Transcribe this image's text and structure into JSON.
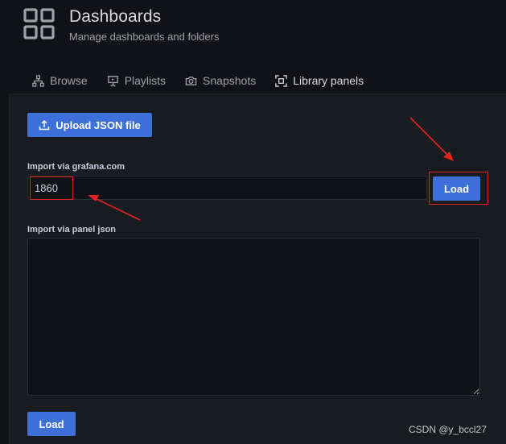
{
  "header": {
    "icon": "dashboards-grid-icon",
    "title": "Dashboards",
    "subtitle": "Manage dashboards and folders"
  },
  "tabs": [
    {
      "label": "Browse",
      "icon": "sitemap-icon",
      "active": false
    },
    {
      "label": "Playlists",
      "icon": "presentation-icon",
      "active": false
    },
    {
      "label": "Snapshots",
      "icon": "camera-icon",
      "active": false
    },
    {
      "label": "Library panels",
      "icon": "library-panel-icon",
      "active": true
    }
  ],
  "import": {
    "upload_label": "Upload JSON file",
    "upload_icon": "upload-icon",
    "gcom_label": "Import via grafana.com",
    "gcom_value": "1860",
    "gcom_load_label": "Load",
    "json_label": "Import via panel json",
    "json_value": "",
    "json_load_label": "Load"
  },
  "watermark": "CSDN @y_bccl27",
  "colors": {
    "primary": "#3d71d9",
    "background": "#111217",
    "panel": "#181b1f",
    "annotation": "#e02424"
  }
}
